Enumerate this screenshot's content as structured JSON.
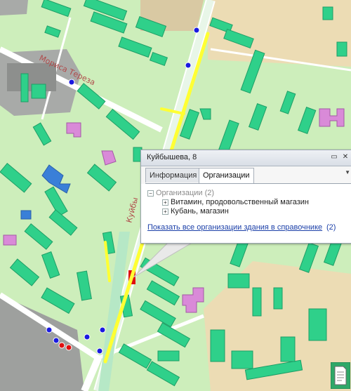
{
  "map": {
    "street_moris_tereza": "Мориса Тереза",
    "street_kuybysheva": "Куйбы",
    "route_color": "#ffff33",
    "building_color": "#2fd08a",
    "ground_color": "#cdeebb",
    "marker_color": "#1a1ae0",
    "selected_building_color": "#e01010"
  },
  "popup": {
    "title": "Куйбышева, 8",
    "tabs": [
      {
        "label": "Информация",
        "active": false
      },
      {
        "label": "Организации",
        "active": true
      }
    ],
    "tree": {
      "root_label": "Организации (2)",
      "items": [
        {
          "label": "Витамин, продовольственный магазин"
        },
        {
          "label": "Кубань, магазин"
        }
      ]
    },
    "all_orgs_link": "Показать все организации здания в справочнике",
    "all_orgs_count": "(2)"
  }
}
